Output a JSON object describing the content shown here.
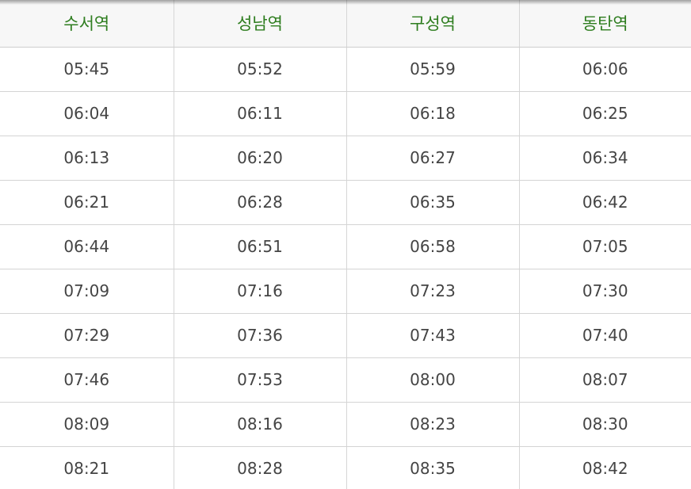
{
  "timetable": {
    "headers": [
      "수서역",
      "성남역",
      "구성역",
      "동탄역"
    ],
    "rows": [
      [
        "05:45",
        "05:52",
        "05:59",
        "06:06"
      ],
      [
        "06:04",
        "06:11",
        "06:18",
        "06:25"
      ],
      [
        "06:13",
        "06:20",
        "06:27",
        "06:34"
      ],
      [
        "06:21",
        "06:28",
        "06:35",
        "06:42"
      ],
      [
        "06:44",
        "06:51",
        "06:58",
        "07:05"
      ],
      [
        "07:09",
        "07:16",
        "07:23",
        "07:30"
      ],
      [
        "07:29",
        "07:36",
        "07:43",
        "07:40"
      ],
      [
        "07:46",
        "07:53",
        "08:00",
        "08:07"
      ],
      [
        "08:09",
        "08:16",
        "08:23",
        "08:30"
      ],
      [
        "08:21",
        "08:28",
        "08:35",
        "08:42"
      ]
    ]
  },
  "colors": {
    "header_text": "#2e7d1f",
    "header_bg": "#f7f7f7",
    "cell_text": "#444444",
    "grid": "#d4d4d4"
  }
}
